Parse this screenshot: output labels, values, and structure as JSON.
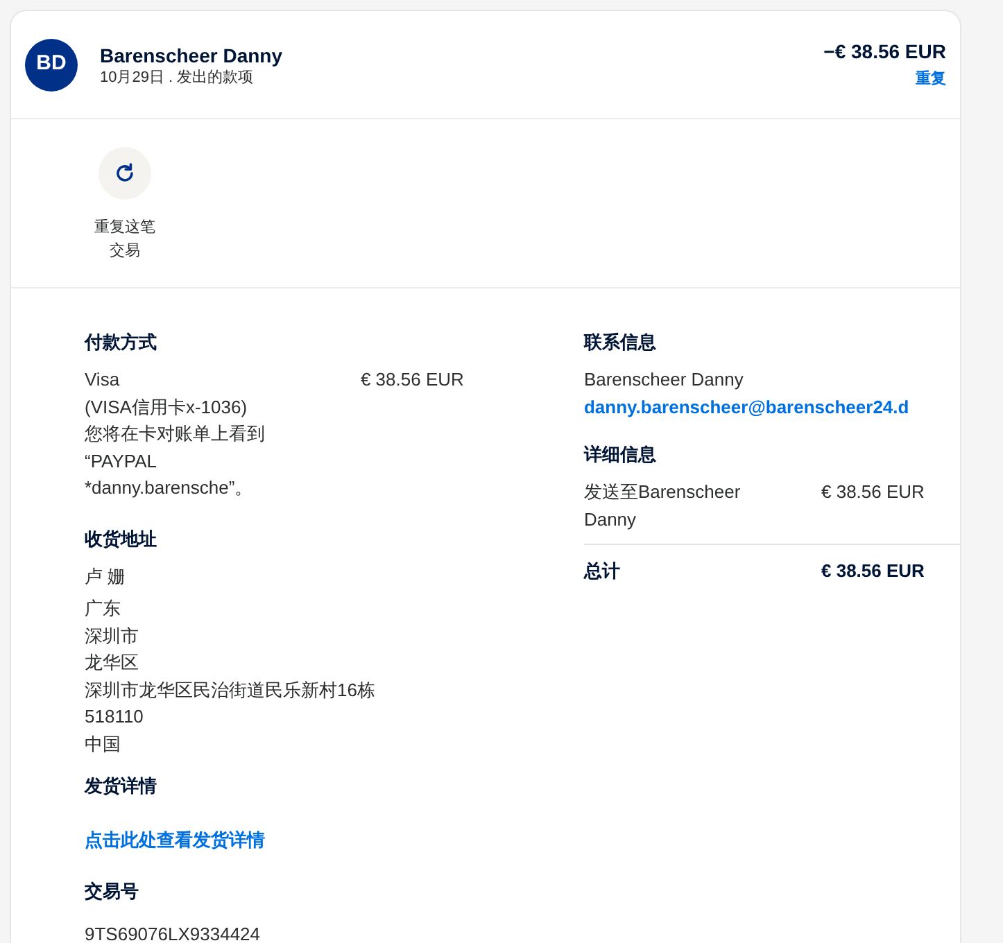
{
  "header": {
    "avatar": "BD",
    "name": "Barenscheer Danny",
    "subtitle": "10月29日 . 发出的款项",
    "amount": "−€ 38.56 EUR",
    "link": "重复"
  },
  "actions": [
    {
      "label": "重复这笔交易"
    }
  ],
  "payment": {
    "title": "付款方式",
    "method": "Visa",
    "amount": "€ 38.56 EUR",
    "lines": [
      "(VISA信用卡x-1036)",
      "您将在卡对账单上看到",
      "“PAYPAL",
      "*danny.barensche”。"
    ]
  },
  "shipping_address": {
    "title": "收货地址",
    "name": "卢 姗",
    "lines": [
      "广东",
      "深圳市",
      "龙华区",
      "深圳市龙华区民治街道民乐新村16栋",
      "518110",
      "中国"
    ]
  },
  "shipping_details": {
    "title": "发货详情",
    "link": "点击此处查看发货详情"
  },
  "transaction": {
    "title": "交易号",
    "id": "9TS69076LX9334424"
  },
  "contact": {
    "title": "联系信息",
    "name": "Barenscheer Danny",
    "email": "danny.barenscheer@barenscheer24.d"
  },
  "details": {
    "title": "详细信息",
    "items": [
      {
        "label": "发送至Barenscheer Danny",
        "amount": "€ 38.56 EUR"
      }
    ],
    "total_label": "总计",
    "total": "€ 38.56 EUR"
  }
}
